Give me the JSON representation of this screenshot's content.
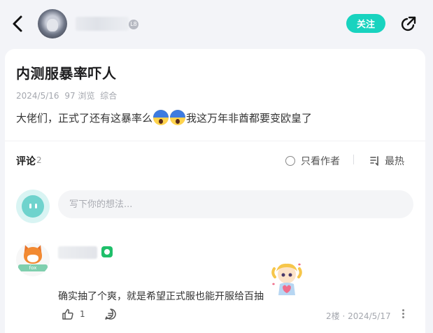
{
  "header": {
    "back_icon": "chevron-left-icon",
    "level_badge": "L8",
    "follow_label": "关注",
    "share_icon": "share-icon",
    "follow_color": "#18d3bf"
  },
  "post": {
    "title": "内测服暴率吓人",
    "date": "2024/5/16",
    "views": "97 浏览",
    "category": "综合",
    "body_before": "大佬们，正式了还有这暴率么",
    "body_after": "我这万年非酋都要变欧皇了",
    "emoji_icons": [
      "scream-emoji-icon",
      "scream-emoji-icon"
    ]
  },
  "comments_bar": {
    "label": "评论",
    "count": "2",
    "author_only": "只看作者",
    "sort": "最热"
  },
  "composer": {
    "placeholder": "写下你的想法..."
  },
  "comment": {
    "text": "确实抽了个爽，就是希望正式服也能开服给百抽",
    "likes": "1",
    "floor": "2楼 · 2024/5/17",
    "avatar_ribbon": "fox"
  }
}
